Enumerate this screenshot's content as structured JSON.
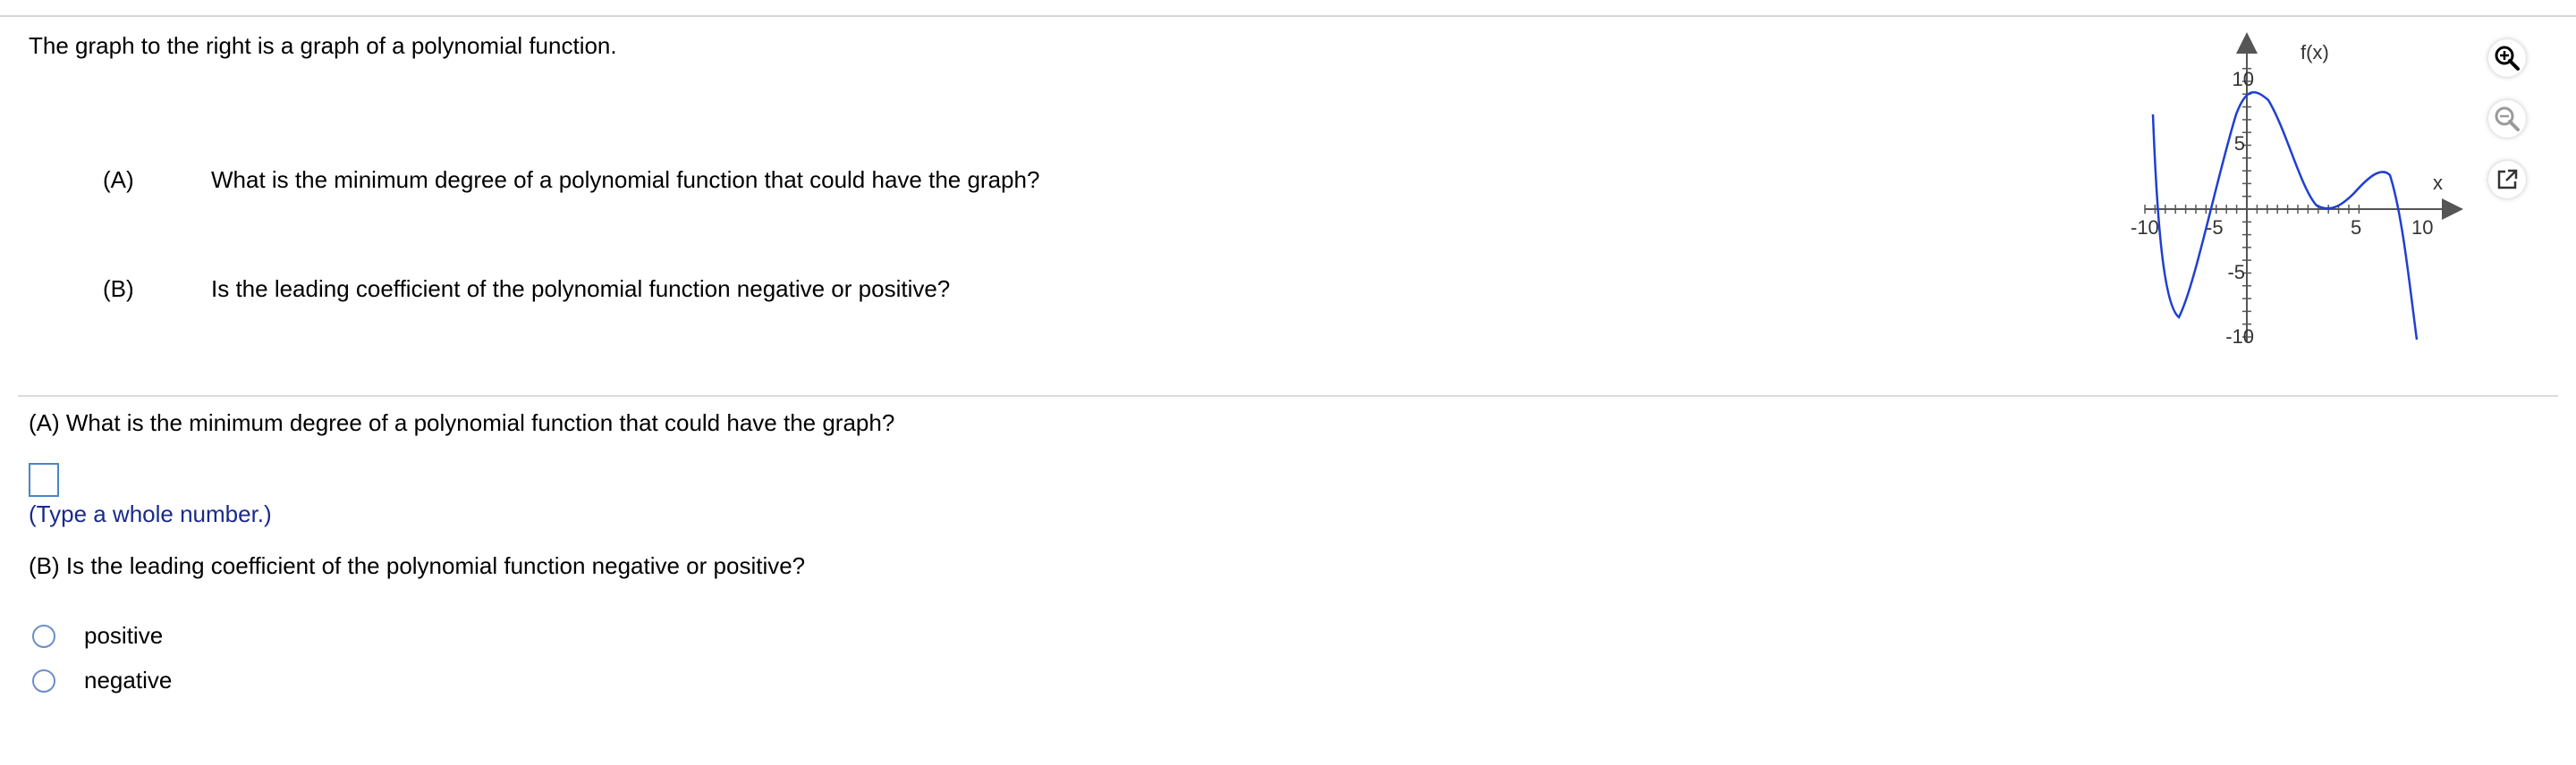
{
  "intro": "The graph to the right is a graph of a polynomial function.",
  "parts": [
    {
      "label": "(A)",
      "text": "What is the minimum degree of a polynomial function that could have the graph?"
    },
    {
      "label": "(B)",
      "text": "Is the leading coefficient of the polynomial function negative or positive?"
    }
  ],
  "question_a": "(A) What is the minimum degree of a polynomial function that could have the graph?",
  "answer_a": {
    "value": "",
    "hint": "(Type a whole number.)"
  },
  "question_b": "(B) Is the leading coefficient of the polynomial function negative or positive?",
  "options_b": [
    "positive",
    "negative"
  ],
  "graph": {
    "y_axis_label": "f(x)",
    "x_axis_label": "x",
    "x_ticks": [
      "-10",
      "-5",
      "5",
      "10"
    ],
    "y_ticks": [
      "10",
      "5",
      "-5",
      "-10"
    ],
    "curve_color": "#1f3fd1"
  },
  "tools": [
    "zoom-in-icon",
    "zoom-out-icon",
    "open-external-icon"
  ]
}
